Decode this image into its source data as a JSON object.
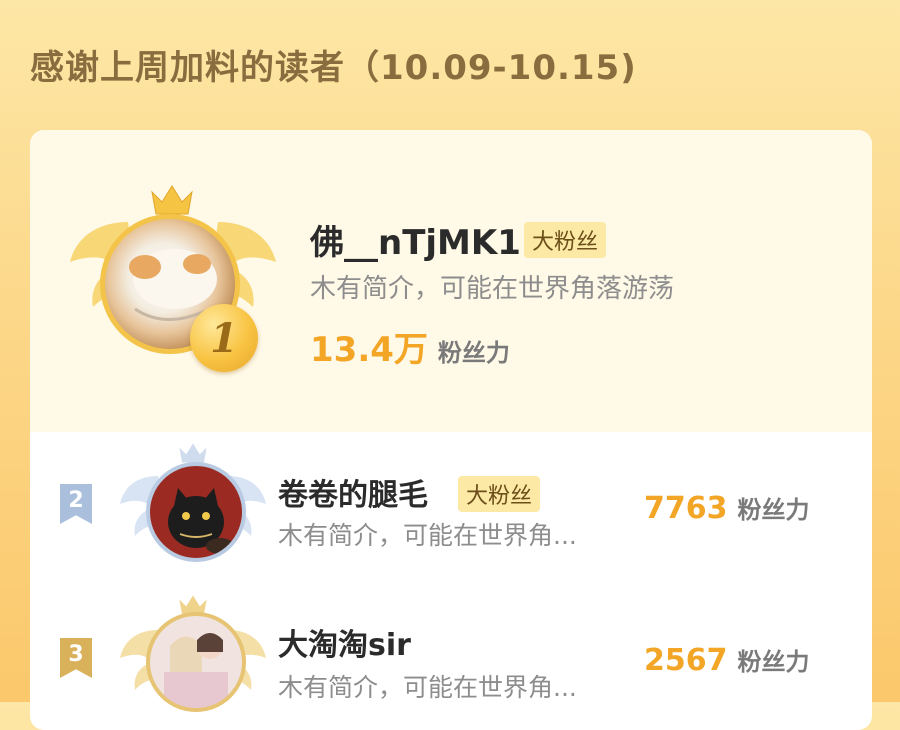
{
  "title": "感谢上周加料的读者（10.09-10.15)",
  "top_reader": {
    "rank": "1",
    "name": "佛__nTjMK1",
    "badge": "大粉丝",
    "bio": "木有简介，可能在世界角落游荡",
    "power_value": "13.4万",
    "power_unit": "粉丝力"
  },
  "readers": [
    {
      "rank": "2",
      "name": "卷卷的腿毛",
      "badge": "大粉丝",
      "bio": "木有简介，可能在世界角...",
      "power_value": "7763",
      "power_unit": "粉丝力"
    },
    {
      "rank": "3",
      "name": "大淘淘sir",
      "bio": "木有简介，可能在世界角...",
      "power_value": "2567",
      "power_unit": "粉丝力"
    }
  ],
  "colors": {
    "accent": "#f3a526",
    "background_top": "#fde7a6",
    "background_bottom": "#fbc86b",
    "rank2_flag": "#a9bfdc",
    "rank3_flag": "#d8b15a"
  }
}
